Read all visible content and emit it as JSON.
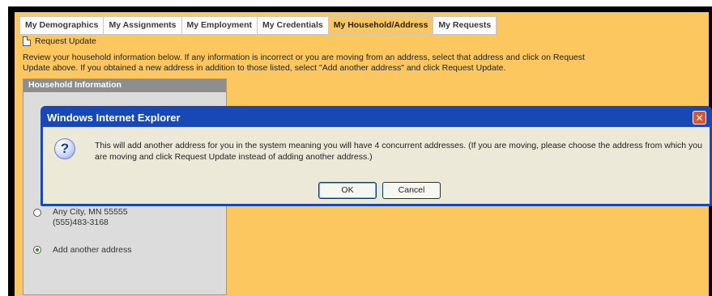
{
  "tabs": [
    {
      "label": "My Demographics"
    },
    {
      "label": "My Assignments"
    },
    {
      "label": "My Employment"
    },
    {
      "label": "My Credentials"
    },
    {
      "label": "My Household/Address"
    },
    {
      "label": "My Requests"
    }
  ],
  "toolbar": {
    "request_update_label": "Request Update"
  },
  "instructions": {
    "line1": "Review your household information below. If any information is incorrect or you are moving from an address, select that address and click on Request",
    "line2": "Update above. If you obtained a new address in addition to those listed, select \"Add another address\" and click Request Update."
  },
  "household": {
    "header": "Household Information",
    "address_city": "Any City, MN 55555",
    "address_phone": "(555)483-3168",
    "add_another_label": "Add another address"
  },
  "dialog": {
    "title": "Windows Internet Explorer",
    "close_glyph": "✕",
    "icon_glyph": "?",
    "message": "This will add another address for you in the system meaning you will have 4 concurrent addresses. (If you are moving, please choose the address from which you are moving and click Request Update instead of adding another address.)",
    "ok_label": "OK",
    "cancel_label": "Cancel"
  }
}
